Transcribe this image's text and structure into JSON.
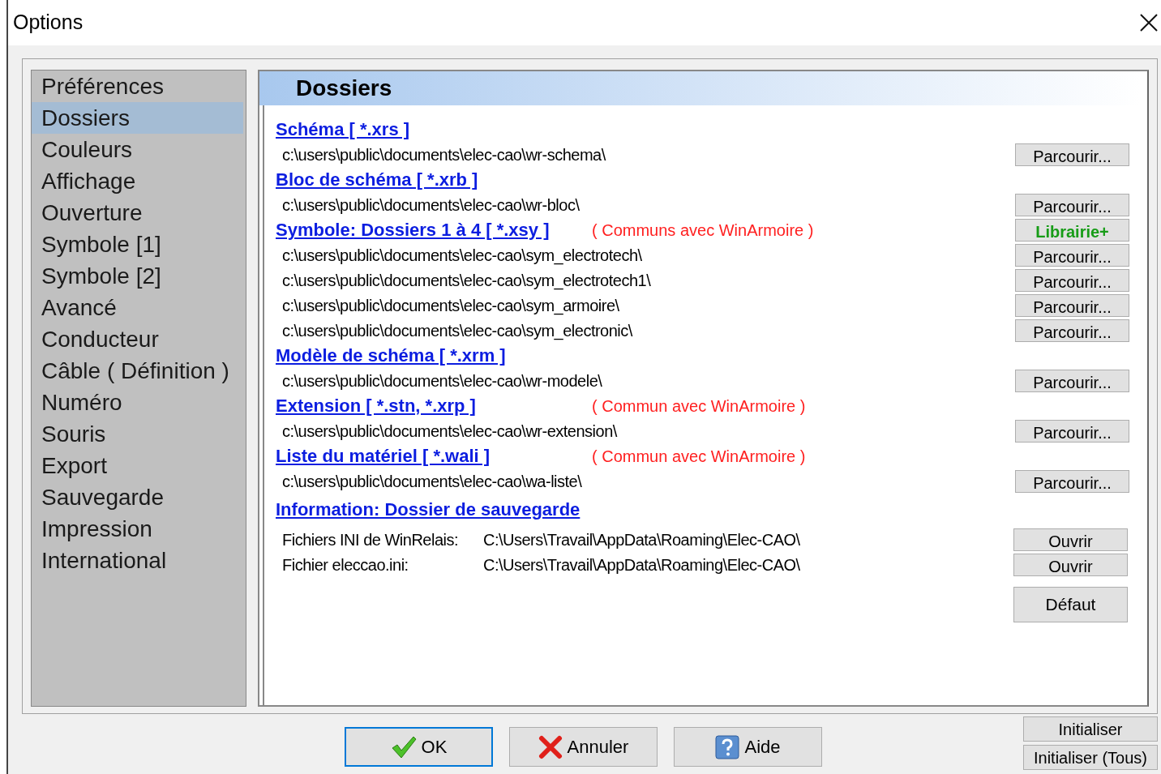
{
  "window": {
    "title": "Options"
  },
  "sidebar": {
    "items": [
      {
        "label": "Préférences",
        "selected": false
      },
      {
        "label": "Dossiers",
        "selected": true
      },
      {
        "label": "Couleurs",
        "selected": false
      },
      {
        "label": "Affichage",
        "selected": false
      },
      {
        "label": "Ouverture",
        "selected": false
      },
      {
        "label": "Symbole [1]",
        "selected": false
      },
      {
        "label": "Symbole [2]",
        "selected": false
      },
      {
        "label": "Avancé",
        "selected": false
      },
      {
        "label": "Conducteur",
        "selected": false
      },
      {
        "label": "Câble ( Définition )",
        "selected": false
      },
      {
        "label": "Numéro",
        "selected": false
      },
      {
        "label": "Souris",
        "selected": false
      },
      {
        "label": "Export",
        "selected": false
      },
      {
        "label": "Sauvegarde",
        "selected": false
      },
      {
        "label": "Impression",
        "selected": false
      },
      {
        "label": "International",
        "selected": false
      }
    ]
  },
  "panel": {
    "title": "Dossiers",
    "rows": [
      {
        "kind": "heading",
        "text": "Schéma [ *.xrs ]"
      },
      {
        "kind": "path",
        "text": "c:\\users\\public\\documents\\elec-cao\\wr-schema\\",
        "button": "Parcourir..."
      },
      {
        "kind": "heading",
        "text": "Bloc de schéma [ *.xrb ]"
      },
      {
        "kind": "path",
        "text": "c:\\users\\public\\documents\\elec-cao\\wr-bloc\\",
        "button": "Parcourir..."
      },
      {
        "kind": "heading",
        "text": "Symbole: Dossiers 1 à 4 [ *.xsy ]",
        "note": "( Communs avec WinArmoire )",
        "button": "Librairie+",
        "button_accent": true
      },
      {
        "kind": "path",
        "text": "c:\\users\\public\\documents\\elec-cao\\sym_electrotech\\",
        "button": "Parcourir..."
      },
      {
        "kind": "path",
        "text": "c:\\users\\public\\documents\\elec-cao\\sym_electrotech1\\",
        "button": "Parcourir..."
      },
      {
        "kind": "path",
        "text": "c:\\users\\public\\documents\\elec-cao\\sym_armoire\\",
        "button": "Parcourir..."
      },
      {
        "kind": "path",
        "text": "c:\\users\\public\\documents\\elec-cao\\sym_electronic\\",
        "button": "Parcourir..."
      },
      {
        "kind": "heading",
        "text": "Modèle de schéma [ *.xrm ]"
      },
      {
        "kind": "path",
        "text": "c:\\users\\public\\documents\\elec-cao\\wr-modele\\",
        "button": "Parcourir..."
      },
      {
        "kind": "heading",
        "text": "Extension [ *.stn, *.xrp ]",
        "note": "( Commun avec WinArmoire )"
      },
      {
        "kind": "path",
        "text": "c:\\users\\public\\documents\\elec-cao\\wr-extension\\",
        "button": "Parcourir..."
      },
      {
        "kind": "heading",
        "text": "Liste du matériel [ *.wali ]",
        "note": "( Commun avec WinArmoire )"
      },
      {
        "kind": "path",
        "text": "c:\\users\\public\\documents\\elec-cao\\wa-liste\\",
        "button": "Parcourir..."
      },
      {
        "kind": "heading",
        "text": "Information: Dossier de sauvegarde"
      },
      {
        "kind": "info",
        "label": "Fichiers INI de WinRelais:",
        "text": "C:\\Users\\Travail\\AppData\\Roaming\\Elec-CAO\\",
        "button": "Ouvrir"
      },
      {
        "kind": "info",
        "label": "Fichier eleccao.ini:",
        "text": "C:\\Users\\Travail\\AppData\\Roaming\\Elec-CAO\\",
        "button": "Ouvrir"
      }
    ],
    "default_button": "Défaut"
  },
  "footer": {
    "buttons": [
      {
        "label": "OK",
        "kind": "ok",
        "selected": true
      },
      {
        "label": "Annuler",
        "kind": "cancel",
        "selected": false
      },
      {
        "label": "Aide",
        "kind": "help",
        "selected": false
      }
    ],
    "reset_buttons": [
      "Initialiser",
      "Initialiser (Tous)"
    ]
  }
}
